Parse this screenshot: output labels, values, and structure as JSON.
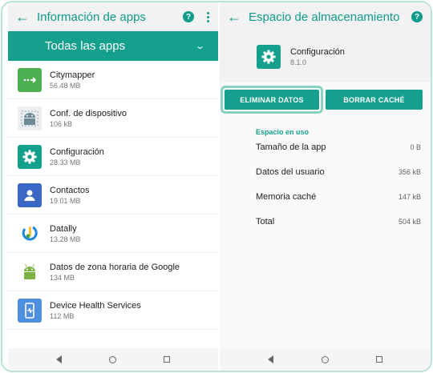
{
  "left": {
    "title": "Información de apps",
    "filter_label": "Todas las apps",
    "apps": [
      {
        "name": "Citymapper",
        "size": "56.48 MB",
        "icon": "citymapper-icon",
        "color": "#4caf50"
      },
      {
        "name": "Conf. de dispositivo",
        "size": "106 kB",
        "icon": "android-icon",
        "color": "#90a4ae"
      },
      {
        "name": "Configuración",
        "size": "28.33 MB",
        "icon": "gear-icon",
        "color": "#14a08d"
      },
      {
        "name": "Contactos",
        "size": "19.01 MB",
        "icon": "contact-icon",
        "color": "#3b68c4"
      },
      {
        "name": "Datally",
        "size": "13.28 MB",
        "icon": "datally-icon",
        "color": "#1e88e5"
      },
      {
        "name": "Datos de zona horaria de Google",
        "size": "134 MB",
        "icon": "android-icon",
        "color": "#7cb342"
      },
      {
        "name": "Device Health Services",
        "size": "112 MB",
        "icon": "device-health-icon",
        "color": "#4f8fe0"
      }
    ]
  },
  "right": {
    "title": "Espacio de almacenamiento",
    "app_name": "Configuración",
    "app_version": "8.1.0",
    "clear_data_label": "ELIMINAR DATOS",
    "clear_cache_label": "BORRAR CACHÉ",
    "section_title": "Espacio en uso",
    "stats": [
      {
        "label": "Tamaño de la app",
        "value": "0 B"
      },
      {
        "label": "Datos del usuario",
        "value": "356 kB"
      },
      {
        "label": "Memoria caché",
        "value": "147 kB"
      },
      {
        "label": "Total",
        "value": "504 kB"
      }
    ]
  },
  "colors": {
    "accent": "#14a08d",
    "highlight": "#87d1c2"
  }
}
